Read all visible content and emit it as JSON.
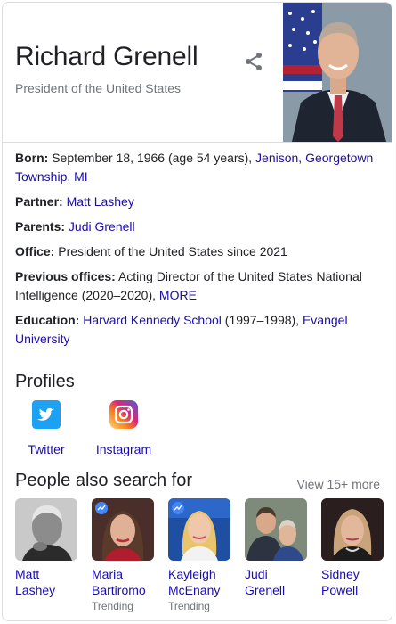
{
  "entity": {
    "name": "Richard Grenell",
    "subtitle": "President of the United States"
  },
  "share": {
    "icon": "share-icon"
  },
  "facts": {
    "born": {
      "label": "Born:",
      "text": " September 18, 1966 (age 54 years), ",
      "link": "Jenison, Georgetown Township, MI"
    },
    "partner": {
      "label": "Partner:",
      "link": "Matt Lashey"
    },
    "parents": {
      "label": "Parents:",
      "link": "Judi Grenell"
    },
    "office": {
      "label": "Office:",
      "text": " President of the United States since 2021"
    },
    "previous": {
      "label": "Previous offices:",
      "text": " Acting Director of the United States National Intelligence (2020–2020), ",
      "link": "MORE"
    },
    "education": {
      "label": "Education:",
      "link1": "Harvard Kennedy School",
      "text": " (1997–1998), ",
      "link2": "Evangel University"
    }
  },
  "profiles": {
    "title": "Profiles",
    "items": [
      {
        "label": "Twitter",
        "icon": "twitter-icon",
        "color": "#1da1f2"
      },
      {
        "label": "Instagram",
        "icon": "instagram-icon",
        "color": "#c13584"
      }
    ]
  },
  "people": {
    "title": "People also search for",
    "view_more": "View 15+ more",
    "items": [
      {
        "first": "Matt",
        "last": "Lashey",
        "trend": ""
      },
      {
        "first": "Maria",
        "last": "Bartiromo",
        "trend": "Trending"
      },
      {
        "first": "Kayleigh",
        "last": "McEnany",
        "trend": "Trending"
      },
      {
        "first": "Judi",
        "last": "Grenell",
        "trend": ""
      },
      {
        "first": "Sidney",
        "last": "Powell",
        "trend": ""
      }
    ]
  },
  "colors": {
    "link": "#1a0dab",
    "muted": "#70757a",
    "border": "#dadce0"
  }
}
